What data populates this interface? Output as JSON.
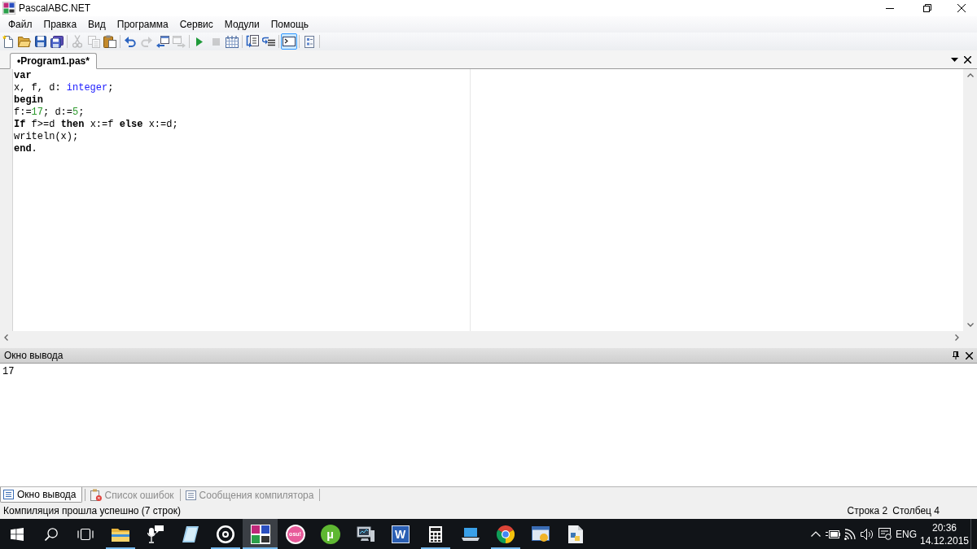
{
  "window": {
    "title": "PascalABC.NET"
  },
  "menu": [
    "Файл",
    "Правка",
    "Вид",
    "Программа",
    "Сервис",
    "Модули",
    "Помощь"
  ],
  "toolbar": {
    "groups": [
      {
        "buttons": [
          {
            "kind": "new",
            "disabled": false,
            "pressed": false
          },
          {
            "kind": "open",
            "disabled": false,
            "pressed": false
          },
          {
            "kind": "save",
            "disabled": false,
            "pressed": false
          },
          {
            "kind": "save-all",
            "disabled": false,
            "pressed": false
          }
        ]
      },
      {
        "buttons": [
          {
            "kind": "cut",
            "disabled": true,
            "pressed": false
          },
          {
            "kind": "copy",
            "disabled": true,
            "pressed": false
          },
          {
            "kind": "paste",
            "disabled": false,
            "pressed": false
          }
        ]
      },
      {
        "buttons": [
          {
            "kind": "undo",
            "disabled": false,
            "pressed": false
          },
          {
            "kind": "redo",
            "disabled": true,
            "pressed": false
          },
          {
            "kind": "window-back",
            "disabled": false,
            "pressed": false
          },
          {
            "kind": "window-forward",
            "disabled": true,
            "pressed": false
          }
        ]
      },
      {
        "buttons": [
          {
            "kind": "run",
            "disabled": false,
            "pressed": false
          },
          {
            "kind": "stop",
            "disabled": true,
            "pressed": false
          },
          {
            "kind": "grid",
            "disabled": false,
            "pressed": false
          }
        ]
      },
      {
        "buttons": [
          {
            "kind": "step-into",
            "disabled": false,
            "pressed": false
          },
          {
            "kind": "step-over",
            "disabled": false,
            "pressed": false
          }
        ]
      },
      {
        "buttons": [
          {
            "kind": "console",
            "disabled": false,
            "pressed": true
          }
        ]
      },
      {
        "buttons": [
          {
            "kind": "document",
            "disabled": false,
            "pressed": false
          }
        ]
      }
    ]
  },
  "editor_tabs": [
    {
      "label": "•Program1.pas*",
      "selected": true
    }
  ],
  "editor": {
    "lines": [
      [
        {
          "text": "var",
          "kind": "keyword"
        }
      ],
      [
        {
          "text": "x, f, d: ",
          "kind": "plain"
        },
        {
          "text": "integer",
          "kind": "type"
        },
        {
          "text": ";",
          "kind": "plain"
        }
      ],
      [
        {
          "text": "begin",
          "kind": "keyword"
        }
      ],
      [
        {
          "text": "f:=",
          "kind": "plain"
        },
        {
          "text": "17",
          "kind": "number"
        },
        {
          "text": "; d:=",
          "kind": "plain"
        },
        {
          "text": "5",
          "kind": "number"
        },
        {
          "text": ";",
          "kind": "plain"
        }
      ],
      [
        {
          "text": "If",
          "kind": "keyword"
        },
        {
          "text": " f>=d ",
          "kind": "plain"
        },
        {
          "text": "then",
          "kind": "keyword"
        },
        {
          "text": " x:=f ",
          "kind": "plain"
        },
        {
          "text": "else",
          "kind": "keyword"
        },
        {
          "text": " x:=d;",
          "kind": "plain"
        }
      ],
      [
        {
          "text": "writeln(x);",
          "kind": "plain"
        }
      ],
      [
        {
          "text": "end",
          "kind": "keyword"
        },
        {
          "text": ".",
          "kind": "plain"
        }
      ]
    ]
  },
  "output_panel": {
    "title": "Окно вывода",
    "text": "17"
  },
  "bottom_tabs": [
    {
      "label": "Окно вывода",
      "kind": "output",
      "selected": true
    },
    {
      "label": "Список ошибок",
      "kind": "errors",
      "selected": false
    },
    {
      "label": "Сообщения компилятора",
      "kind": "messages",
      "selected": false
    }
  ],
  "status_bar": {
    "message": "Компиляция прошла успешно (7 строк)",
    "line": "Строка 2",
    "column": "Столбец 4"
  },
  "taskbar": {
    "system": [
      {
        "kind": "start"
      },
      {
        "kind": "search"
      },
      {
        "kind": "task-view"
      }
    ],
    "apps": [
      {
        "kind": "folder",
        "running": true,
        "selected": false
      },
      {
        "kind": "microphone",
        "running": false,
        "selected": false
      },
      {
        "kind": "notepad",
        "running": false,
        "selected": false
      },
      {
        "kind": "disc",
        "running": true,
        "selected": false
      },
      {
        "kind": "tiles",
        "running": true,
        "selected": true
      },
      {
        "kind": "badge",
        "label": "osu!",
        "running": false,
        "selected": false
      },
      {
        "kind": "green-badge",
        "label": "µ",
        "running": false,
        "selected": false
      },
      {
        "kind": "monitor",
        "running": false,
        "selected": false
      },
      {
        "kind": "blue-badge",
        "label": "W",
        "running": false,
        "selected": false
      },
      {
        "kind": "calculator",
        "running": true,
        "selected": false
      },
      {
        "kind": "laptop",
        "running": false,
        "selected": false
      },
      {
        "kind": "browser",
        "running": true,
        "selected": false
      },
      {
        "kind": "window",
        "running": false,
        "selected": false
      },
      {
        "kind": "script",
        "running": false,
        "selected": false
      }
    ],
    "tray": {
      "language": "ENG",
      "time": "20:36",
      "date": "14.12.2015"
    }
  }
}
